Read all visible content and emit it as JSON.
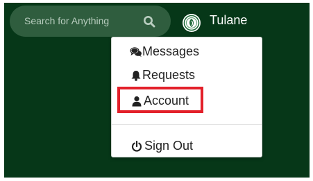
{
  "header": {
    "search": {
      "placeholder": "Search for Anything",
      "icon": "search-icon"
    },
    "org": {
      "logo_icon": "tulane-seal-icon",
      "name": "Tulane"
    }
  },
  "user_menu": {
    "items": [
      {
        "label": "Messages",
        "icon": "comments-icon"
      },
      {
        "label": "Requests",
        "icon": "bell-icon"
      },
      {
        "label": "Account",
        "icon": "user-icon",
        "highlighted": true
      },
      {
        "label": "Sign Out",
        "icon": "power-icon"
      }
    ]
  },
  "colors": {
    "header_bg": "#063718",
    "search_bg": "#2f5d3e",
    "highlight": "#e3202a",
    "menu_bg": "#ffffff"
  }
}
